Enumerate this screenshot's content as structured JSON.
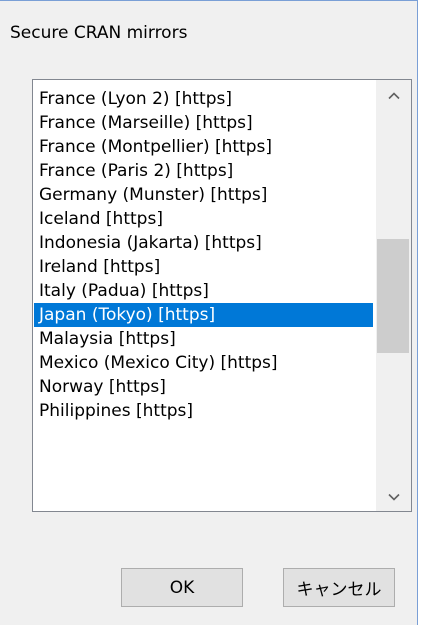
{
  "dialog": {
    "title": "Secure CRAN mirrors"
  },
  "mirrors": {
    "items": [
      "France (Lyon 2) [https]",
      "France (Marseille) [https]",
      "France (Montpellier) [https]",
      "France (Paris 2) [https]",
      "Germany (Munster) [https]",
      "Iceland [https]",
      "Indonesia (Jakarta) [https]",
      "Ireland [https]",
      "Italy (Padua) [https]",
      "Japan (Tokyo) [https]",
      "Malaysia [https]",
      "Mexico (Mexico City) [https]",
      "Norway [https]",
      "Philippines [https]"
    ],
    "selected": "Japan (Tokyo) [https]"
  },
  "buttons": {
    "ok_label": "OK",
    "cancel_label": "キャンセル"
  },
  "icons": {
    "scroll_up": "chevron-up-icon",
    "scroll_down": "chevron-down-icon"
  },
  "colors": {
    "selection": "#0078d7",
    "selection_text": "#ffffff",
    "window_bg": "#f0f0f0",
    "scroll_thumb": "#cdcdcd"
  }
}
